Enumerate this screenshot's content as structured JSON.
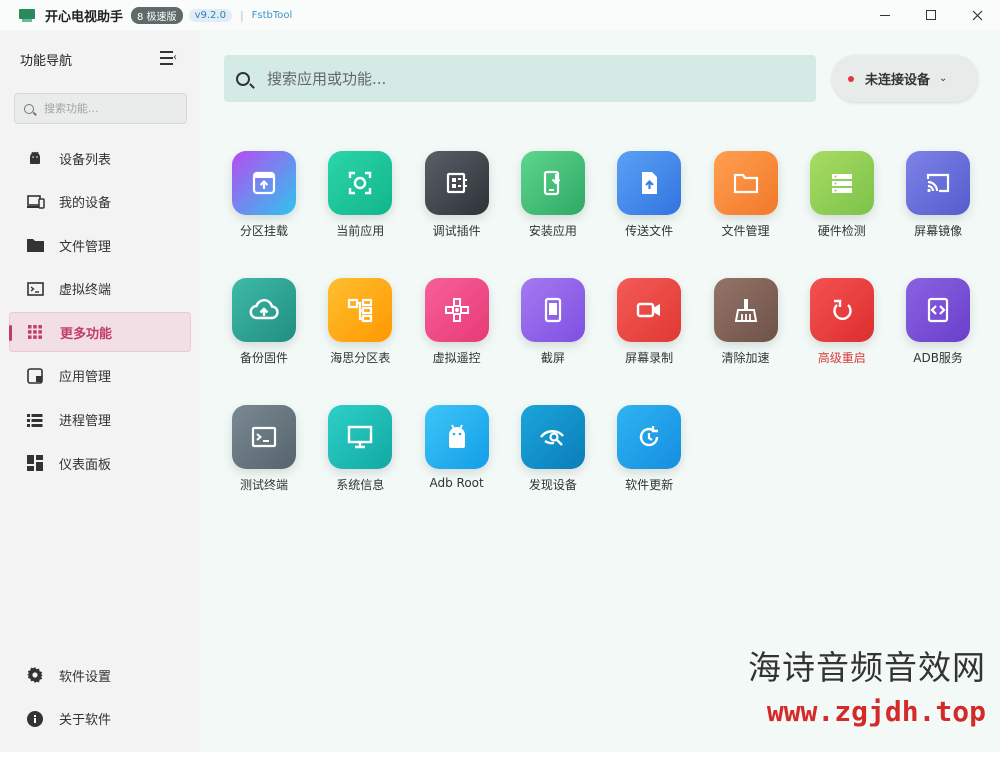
{
  "titlebar": {
    "app_name": "开心电视助手",
    "badge_fast": "8 极速版",
    "version": "v9.2.0",
    "separator": "|",
    "brand": "FstbTool",
    "controls": [
      "minimize-icon",
      "maximize-icon",
      "close-icon"
    ]
  },
  "sidebar": {
    "title": "功能导航",
    "search_placeholder": "搜索功能...",
    "items": [
      {
        "label": "设备列表",
        "icon": "android-icon"
      },
      {
        "label": "我的设备",
        "icon": "devices-icon"
      },
      {
        "label": "文件管理",
        "icon": "folder-icon"
      },
      {
        "label": "虚拟终端",
        "icon": "terminal-icon"
      },
      {
        "label": "更多功能",
        "icon": "grid-icon",
        "active": true
      },
      {
        "label": "应用管理",
        "icon": "apps-icon"
      },
      {
        "label": "进程管理",
        "icon": "list-icon"
      },
      {
        "label": "仪表面板",
        "icon": "dashboard-icon"
      }
    ],
    "bottom": [
      {
        "label": "软件设置",
        "icon": "gear-icon"
      },
      {
        "label": "关于软件",
        "icon": "info-icon"
      }
    ],
    "active_color": "#c33b6b"
  },
  "main": {
    "search_placeholder": "搜索应用或功能...",
    "device_status": "未连接设备",
    "device_status_color": "#e0383e",
    "tiles": [
      {
        "label": "分区挂载",
        "icon": "partition-mount-icon",
        "c1": "#b64cf0",
        "c2": "#2ec5ee"
      },
      {
        "label": "当前应用",
        "icon": "screenshot-frame-icon",
        "c1": "#2bd6a8",
        "c2": "#12b58c"
      },
      {
        "label": "调试插件",
        "icon": "debug-plugin-icon",
        "c1": "#5a6068",
        "c2": "#2e3238"
      },
      {
        "label": "安装应用",
        "icon": "install-app-icon",
        "c1": "#5fd68e",
        "c2": "#2ea865"
      },
      {
        "label": "传送文件",
        "icon": "file-upload-icon",
        "c1": "#5aa1f5",
        "c2": "#3274e0"
      },
      {
        "label": "文件管理",
        "icon": "folder-icon",
        "c1": "#ffa04f",
        "c2": "#f2782a"
      },
      {
        "label": "硬件检测",
        "icon": "hardware-icon",
        "c1": "#a8dc63",
        "c2": "#7cc24a"
      },
      {
        "label": "屏幕镜像",
        "icon": "cast-icon",
        "c1": "#7e83e8",
        "c2": "#555ccc"
      },
      {
        "label": "备份固件",
        "icon": "cloud-upload-icon",
        "c1": "#3fbaa9",
        "c2": "#208e80"
      },
      {
        "label": "海思分区表",
        "icon": "partition-table-icon",
        "c1": "#ffbf30",
        "c2": "#ff9800"
      },
      {
        "label": "虚拟遥控",
        "icon": "gamepad-icon",
        "c1": "#f7609a",
        "c2": "#e73a75"
      },
      {
        "label": "截屏",
        "icon": "phone-screenshot-icon",
        "c1": "#a57af0",
        "c2": "#7e4fe2"
      },
      {
        "label": "屏幕录制",
        "icon": "video-record-icon",
        "c1": "#f45b57",
        "c2": "#e03833"
      },
      {
        "label": "清除加速",
        "icon": "broom-icon",
        "c1": "#947468",
        "c2": "#6e5248"
      },
      {
        "label": "高级重启",
        "icon": "restart-icon",
        "c1": "#f45252",
        "c2": "#dd2e2e",
        "red": true
      },
      {
        "label": "ADB服务",
        "icon": "adb-service-icon",
        "c1": "#8b62e0",
        "c2": "#6a3fcc"
      },
      {
        "label": "测试终端",
        "icon": "terminal-icon",
        "c1": "#7a8993",
        "c2": "#55636c"
      },
      {
        "label": "系统信息",
        "icon": "monitor-icon",
        "c1": "#2ed0c9",
        "c2": "#12a8a2"
      },
      {
        "label": "Adb Root",
        "icon": "android-icon",
        "c1": "#3ec6f8",
        "c2": "#129de8"
      },
      {
        "label": "发现设备",
        "icon": "discover-eye-icon",
        "c1": "#1aa6db",
        "c2": "#0b7db8"
      },
      {
        "label": "软件更新",
        "icon": "update-icon",
        "c1": "#2eb4f2",
        "c2": "#158ee0"
      }
    ]
  },
  "watermark": {
    "text": "海诗音频音效网",
    "url": "www.zgjdh.top"
  }
}
